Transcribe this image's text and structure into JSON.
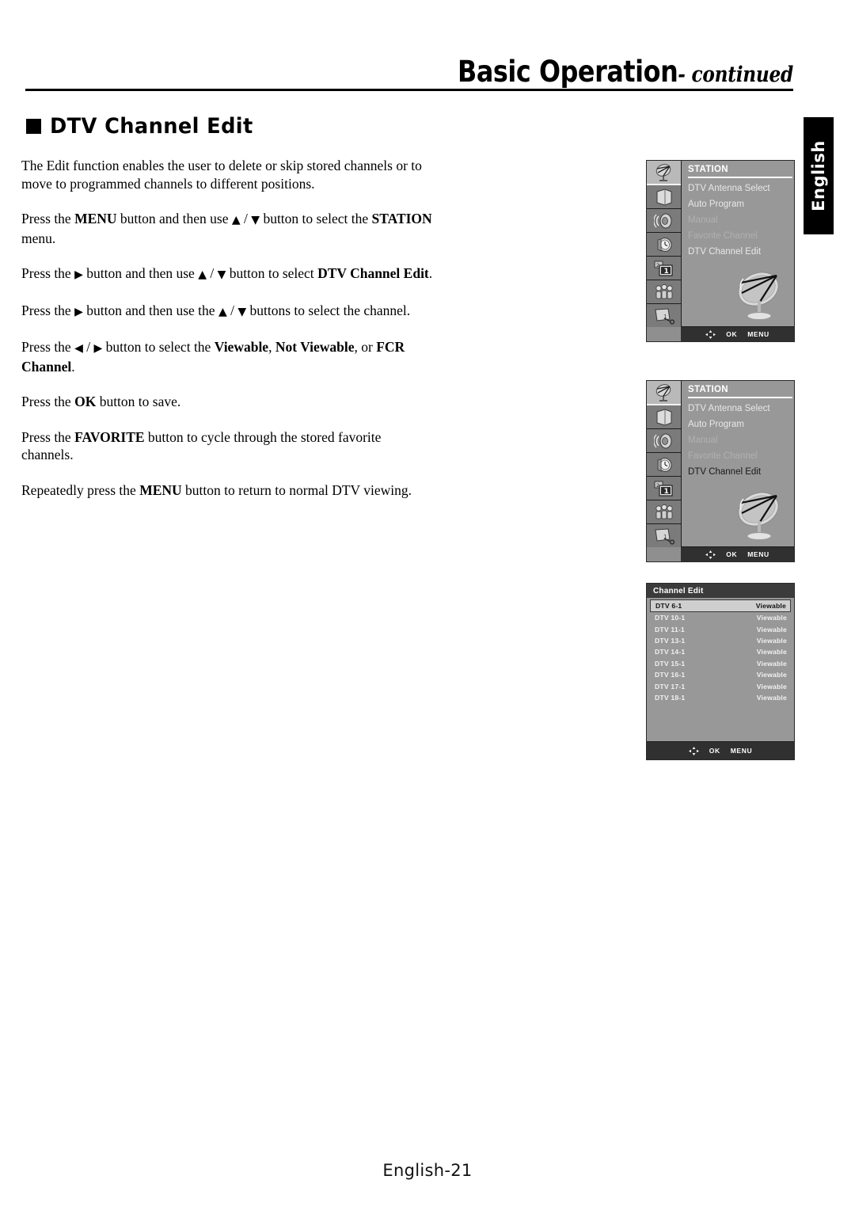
{
  "header": {
    "title_main": "Basic Operation",
    "title_continued": "- continued"
  },
  "section": {
    "heading": "DTV Channel Edit",
    "bullet_icon": "filled-square-icon"
  },
  "side_tab": {
    "label": "English"
  },
  "body": {
    "p1": "The Edit function enables the user to delete or skip stored channels or to move to programmed channels to different positions.",
    "p2_a": "Press the ",
    "p2_menu": "MENU",
    "p2_b": " button and then use ",
    "p2_up": "▲",
    "p2_slash": " / ",
    "p2_down": "▼",
    "p2_c": " button to select the ",
    "p2_station": "STATION",
    "p2_d": " menu.",
    "p3_a": "Press the ",
    "p3_right": "▶",
    "p3_b": " button and then use ",
    "p3_up": "▲",
    "p3_slash": " / ",
    "p3_down": "▼",
    "p3_c": " button to select ",
    "p3_dtv": "DTV Channel Edit",
    "p3_d": ".",
    "p4_a": "Press the ",
    "p4_right": "▶",
    "p4_b": " button and then use the ",
    "p4_up": "▲",
    "p4_slash": " / ",
    "p4_down": "▼",
    "p4_c": " buttons to select the channel.",
    "p5_a": "Press the ",
    "p5_left": "◀",
    "p5_slash": " / ",
    "p5_right": "▶",
    "p5_b": " button to select the ",
    "p5_viewable": "Viewable",
    "p5_comma": ", ",
    "p5_notviewable": "Not Viewable",
    "p5_c": ", or ",
    "p5_fcr": "FCR Channel",
    "p5_d": ".",
    "p6_a": "Press the ",
    "p6_ok": "OK",
    "p6_b": " button to save.",
    "p7_a": "Press the ",
    "p7_favorite": "FAVORITE",
    "p7_b": " button to cycle through the stored favorite channels.",
    "p8_a": "Repeatedly press the ",
    "p8_menu": "MENU",
    "p8_b": " button to return to normal DTV viewing."
  },
  "osd_station": {
    "title": "STATION",
    "items": [
      {
        "label": "DTV Antenna Select",
        "state": "normal"
      },
      {
        "label": "Auto Program",
        "state": "normal"
      },
      {
        "label": "Manual",
        "state": "dim"
      },
      {
        "label": "Favorite Channel",
        "state": "dim"
      },
      {
        "label": "DTV Channel Edit",
        "state": "normal"
      }
    ],
    "items_selected": [
      {
        "label": "DTV Antenna Select",
        "state": "normal"
      },
      {
        "label": "Auto Program",
        "state": "normal"
      },
      {
        "label": "Manual",
        "state": "dim"
      },
      {
        "label": "Favorite Channel",
        "state": "dim"
      },
      {
        "label": "DTV Channel Edit",
        "state": "selected"
      }
    ],
    "rail_icons": [
      "satellite-dish-icon",
      "picture-screen-icon",
      "speaker-sound-icon",
      "clock-time-icon",
      "pip-two-one-icon",
      "setup-people-icon",
      "lock-screen-key-icon"
    ],
    "artwork": "satellite-dish-illustration",
    "footer": {
      "nav": "four-way-nav-icon",
      "ok": "OK",
      "menu": "MENU"
    }
  },
  "channel_edit": {
    "title": "Channel Edit",
    "rows": [
      {
        "channel": "DTV 6-1",
        "status": "Viewable",
        "selected": true
      },
      {
        "channel": "DTV 10-1",
        "status": "Viewable",
        "selected": false
      },
      {
        "channel": "DTV 11-1",
        "status": "Viewable",
        "selected": false
      },
      {
        "channel": "DTV 13-1",
        "status": "Viewable",
        "selected": false
      },
      {
        "channel": "DTV 14-1",
        "status": "Viewable",
        "selected": false
      },
      {
        "channel": "DTV 15-1",
        "status": "Viewable",
        "selected": false
      },
      {
        "channel": "DTV 16-1",
        "status": "Viewable",
        "selected": false
      },
      {
        "channel": "DTV 17-1",
        "status": "Viewable",
        "selected": false
      },
      {
        "channel": "DTV 18-1",
        "status": "Viewable",
        "selected": false
      }
    ],
    "footer": {
      "nav": "four-way-nav-icon",
      "ok": "OK",
      "menu": "MENU"
    }
  },
  "page_footer": {
    "text": "English-21"
  },
  "colors": {
    "page_bg": "#ffffff",
    "ink": "#000000",
    "osd_panel": "#989898",
    "osd_rail": "#7b7b7b",
    "osd_footer_bar": "#303030",
    "osd_highlight": "#cfcfcf",
    "tab_bg": "#000000"
  }
}
